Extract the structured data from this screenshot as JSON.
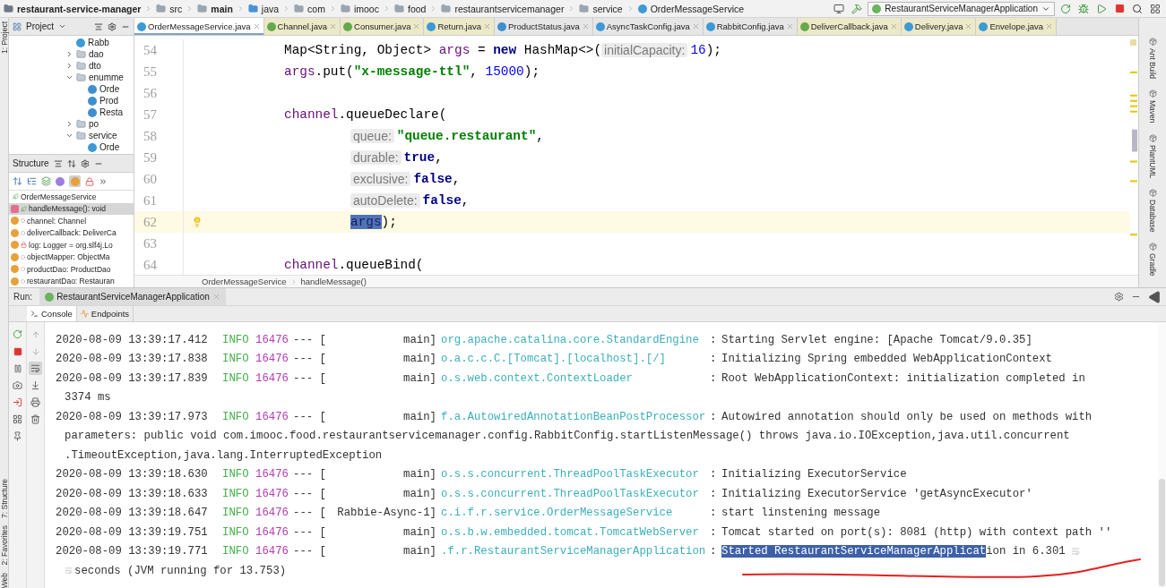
{
  "breadcrumbs": [
    {
      "label": "restaurant-service-manager",
      "kind": "module",
      "bold": true
    },
    {
      "label": "src",
      "kind": "folder",
      "bold": false
    },
    {
      "label": "main",
      "kind": "folder",
      "bold": true
    },
    {
      "label": "java",
      "kind": "source",
      "bold": false
    },
    {
      "label": "com",
      "kind": "folder",
      "bold": false
    },
    {
      "label": "imooc",
      "kind": "folder",
      "bold": false
    },
    {
      "label": "food",
      "kind": "folder",
      "bold": false
    },
    {
      "label": "restaurantservicemanager",
      "kind": "folder",
      "bold": false
    },
    {
      "label": "service",
      "kind": "folder",
      "bold": false
    },
    {
      "label": "OrderMessageService",
      "kind": "class",
      "bold": false
    }
  ],
  "run_configuration": "RestaurantServiceManagerApplication",
  "left_stripe": {
    "top": [
      "1: Project"
    ],
    "bottom": [
      "7: Structure",
      "2: Favorites",
      "Web"
    ]
  },
  "project_panel": {
    "title": "Project",
    "tree": [
      {
        "label": "Rabb",
        "kind": "class"
      },
      {
        "label": "dao",
        "kind": "folder",
        "expanded": false
      },
      {
        "label": "dto",
        "kind": "folder",
        "expanded": false
      },
      {
        "label": "enumme",
        "kind": "folder",
        "expanded": true,
        "children": [
          {
            "label": "Orde",
            "kind": "enum"
          },
          {
            "label": "Prod",
            "kind": "enum"
          },
          {
            "label": "Resta",
            "kind": "enum"
          }
        ]
      },
      {
        "label": "po",
        "kind": "folder",
        "expanded": false
      },
      {
        "label": "service",
        "kind": "folder",
        "expanded": true,
        "children": [
          {
            "label": "Orde",
            "kind": "class"
          }
        ]
      }
    ]
  },
  "structure_panel": {
    "title": "Structure",
    "root": {
      "label": "OrderMessageService",
      "kind": "public-class"
    },
    "items": [
      {
        "label": "handleMessage(): void",
        "kind": "public-method",
        "selected": true
      },
      {
        "label": "channel: Channel",
        "kind": "package-field",
        "selected": false
      },
      {
        "label": "deliverCallback: DeliverCa",
        "kind": "package-field",
        "selected": false
      },
      {
        "label": "log: Logger = org.slf4j.Lo",
        "kind": "private-static-field",
        "selected": false
      },
      {
        "label": "objectMapper: ObjectMa",
        "kind": "package-field",
        "selected": false
      },
      {
        "label": "productDao: ProductDao",
        "kind": "package-field",
        "selected": false
      },
      {
        "label": "restaurantDao: Restauran",
        "kind": "package-field",
        "selected": false
      }
    ]
  },
  "tabs": [
    {
      "label": "OrderMessageService.java",
      "kind": "class",
      "selected": true,
      "library": false
    },
    {
      "label": "Channel.java",
      "kind": "interface",
      "selected": false,
      "library": true
    },
    {
      "label": "Consumer.java",
      "kind": "interface",
      "selected": false,
      "library": true
    },
    {
      "label": "Return.java",
      "kind": "class",
      "selected": false,
      "library": true
    },
    {
      "label": "ProductStatus.java",
      "kind": "enum",
      "selected": false,
      "library": false
    },
    {
      "label": "AsyncTaskConfig.java",
      "kind": "class",
      "selected": false,
      "library": false
    },
    {
      "label": "RabbitConfig.java",
      "kind": "class",
      "selected": false,
      "library": false
    },
    {
      "label": "DeliverCallback.java",
      "kind": "interface",
      "selected": false,
      "library": true
    },
    {
      "label": "Delivery.java",
      "kind": "class",
      "selected": false,
      "library": true
    },
    {
      "label": "Envelope.java",
      "kind": "class",
      "selected": false,
      "library": true
    }
  ],
  "code_lines": [
    {
      "number": "54",
      "kind": "statement",
      "current": false,
      "tokens": [
        {
          "kind": "plain",
          "text": "Map<String, Object> "
        },
        {
          "kind": "field",
          "text": "args"
        },
        {
          "kind": "plain",
          "text": " = "
        },
        {
          "kind": "keyword",
          "text": "new"
        },
        {
          "kind": "plain",
          "text": " HashMap<>("
        },
        {
          "kind": "hint",
          "text": "initialCapacity:"
        },
        {
          "kind": "number",
          "text": "16"
        },
        {
          "kind": "plain",
          "text": ");"
        }
      ]
    },
    {
      "number": "55",
      "kind": "statement",
      "current": false,
      "tokens": [
        {
          "kind": "field",
          "text": "args"
        },
        {
          "kind": "plain",
          "text": ".put("
        },
        {
          "kind": "string",
          "text": "\"x-message-ttl\""
        },
        {
          "kind": "plain",
          "text": ", "
        },
        {
          "kind": "number",
          "text": "15000"
        },
        {
          "kind": "plain",
          "text": ");"
        }
      ]
    },
    {
      "number": "56",
      "kind": "blank",
      "current": false
    },
    {
      "number": "57",
      "kind": "statement",
      "current": false,
      "tokens": [
        {
          "kind": "field",
          "text": "channel"
        },
        {
          "kind": "plain",
          "text": ".queueDeclare("
        }
      ]
    },
    {
      "number": "58",
      "kind": "argument",
      "current": false,
      "tokens": [
        {
          "kind": "hint",
          "text": "queue:"
        },
        {
          "kind": "string",
          "text": "\"queue.restaurant\""
        },
        {
          "kind": "plain",
          "text": ","
        }
      ]
    },
    {
      "number": "59",
      "kind": "argument",
      "current": false,
      "tokens": [
        {
          "kind": "hint",
          "text": "durable:"
        },
        {
          "kind": "keyword",
          "text": "true"
        },
        {
          "kind": "plain",
          "text": ","
        }
      ]
    },
    {
      "number": "60",
      "kind": "argument",
      "current": false,
      "tokens": [
        {
          "kind": "hint",
          "text": "exclusive:"
        },
        {
          "kind": "keyword",
          "text": "false"
        },
        {
          "kind": "plain",
          "text": ","
        }
      ]
    },
    {
      "number": "61",
      "kind": "argument",
      "current": false,
      "tokens": [
        {
          "kind": "hint",
          "text": "autoDelete:"
        },
        {
          "kind": "keyword",
          "text": "false"
        },
        {
          "kind": "plain",
          "text": ","
        }
      ]
    },
    {
      "number": "62",
      "kind": "argument",
      "current": true,
      "tokens": [
        {
          "kind": "selected",
          "text": "args"
        },
        {
          "kind": "plain",
          "text": ");"
        }
      ]
    },
    {
      "number": "63",
      "kind": "blank",
      "current": false
    },
    {
      "number": "64",
      "kind": "statement",
      "current": false,
      "tokens": [
        {
          "kind": "field",
          "text": "channel"
        },
        {
          "kind": "plain",
          "text": ".queueBind("
        }
      ]
    }
  ],
  "editor_breadcrumbs": [
    "OrderMessageService",
    "handleMessage()"
  ],
  "right_stripe": [
    "Ant Build",
    "Maven",
    "PlantUML",
    "Database",
    "Gradle"
  ],
  "run_panel": {
    "label": "Run:",
    "tab": "RestaurantServiceManagerApplication"
  },
  "console_tabs": [
    {
      "label": "Console",
      "selected": true
    },
    {
      "label": "Endpoints",
      "selected": false
    }
  ],
  "log": [
    {
      "kind": "entry",
      "time": "2020-08-09 13:39:17.412",
      "level": "INFO",
      "pid": "16476",
      "separator": "--- [",
      "thread": "main]",
      "logger": "org.apache.catalina.core.StandardEngine",
      "delimiter": ":",
      "message": "Starting Servlet engine: [Apache Tomcat/9.0.35]"
    },
    {
      "kind": "entry",
      "time": "2020-08-09 13:39:17.838",
      "level": "INFO",
      "pid": "16476",
      "separator": "--- [",
      "thread": "main]",
      "logger": "o.a.c.c.C.[Tomcat].[localhost].[/]",
      "delimiter": ":",
      "message": "Initializing Spring embedded WebApplicationContext"
    },
    {
      "kind": "entry",
      "time": "2020-08-09 13:39:17.839",
      "level": "INFO",
      "pid": "16476",
      "separator": "--- [",
      "thread": "main]",
      "logger": "o.s.web.context.ContextLoader",
      "delimiter": ":",
      "message": "Root WebApplicationContext: initialization completed in"
    },
    {
      "kind": "continuation",
      "text": "3374 ms",
      "wrapped": false
    },
    {
      "kind": "entry",
      "time": "2020-08-09 13:39:17.973",
      "level": "INFO",
      "pid": "16476",
      "separator": "--- [",
      "thread": "main]",
      "logger": "f.a.AutowiredAnnotationBeanPostProcessor",
      "delimiter": ":",
      "message": "Autowired annotation should only be used on methods with"
    },
    {
      "kind": "continuation",
      "text": "parameters: public void com.imooc.food.restaurantservicemanager.config.RabbitConfig.startListenMessage() throws java.io.IOException,java.util.concurrent",
      "wrapped": false
    },
    {
      "kind": "continuation",
      "text": ".TimeoutException,java.lang.InterruptedException",
      "wrapped": false
    },
    {
      "kind": "entry",
      "time": "2020-08-09 13:39:18.630",
      "level": "INFO",
      "pid": "16476",
      "separator": "--- [",
      "thread": "main]",
      "logger": "o.s.s.concurrent.ThreadPoolTaskExecutor",
      "delimiter": ":",
      "message": "Initializing ExecutorService"
    },
    {
      "kind": "entry",
      "time": "2020-08-09 13:39:18.633",
      "level": "INFO",
      "pid": "16476",
      "separator": "--- [",
      "thread": "main]",
      "logger": "o.s.s.concurrent.ThreadPoolTaskExecutor",
      "delimiter": ":",
      "message": "Initializing ExecutorService 'getAsyncExecutor'"
    },
    {
      "kind": "entry",
      "time": "2020-08-09 13:39:18.647",
      "level": "INFO",
      "pid": "16476",
      "separator": "--- [",
      "thread": "Rabbie-Async-1]",
      "logger": "c.i.f.r.service.OrderMessageService",
      "delimiter": ":",
      "message": "start linstening message"
    },
    {
      "kind": "entry",
      "time": "2020-08-09 13:39:19.751",
      "level": "INFO",
      "pid": "16476",
      "separator": "--- [",
      "thread": "main]",
      "logger": "o.s.b.w.embedded.tomcat.TomcatWebServer",
      "delimiter": ":",
      "message": "Tomcat started on port(s): 8081 (http) with context path ''"
    },
    {
      "kind": "entry",
      "time": "2020-08-09 13:39:19.771",
      "level": "INFO",
      "pid": "16476",
      "separator": "--- [",
      "thread": "main]",
      "logger": ".f.r.RestaurantServiceManagerApplication",
      "delimiter": ":",
      "selection": "Started RestaurantServiceManagerApplicat",
      "message": "ion in 6.301",
      "wrapped": true
    },
    {
      "kind": "continuation",
      "text": "seconds (JVM running for 13.753)",
      "wrapped": true
    }
  ]
}
